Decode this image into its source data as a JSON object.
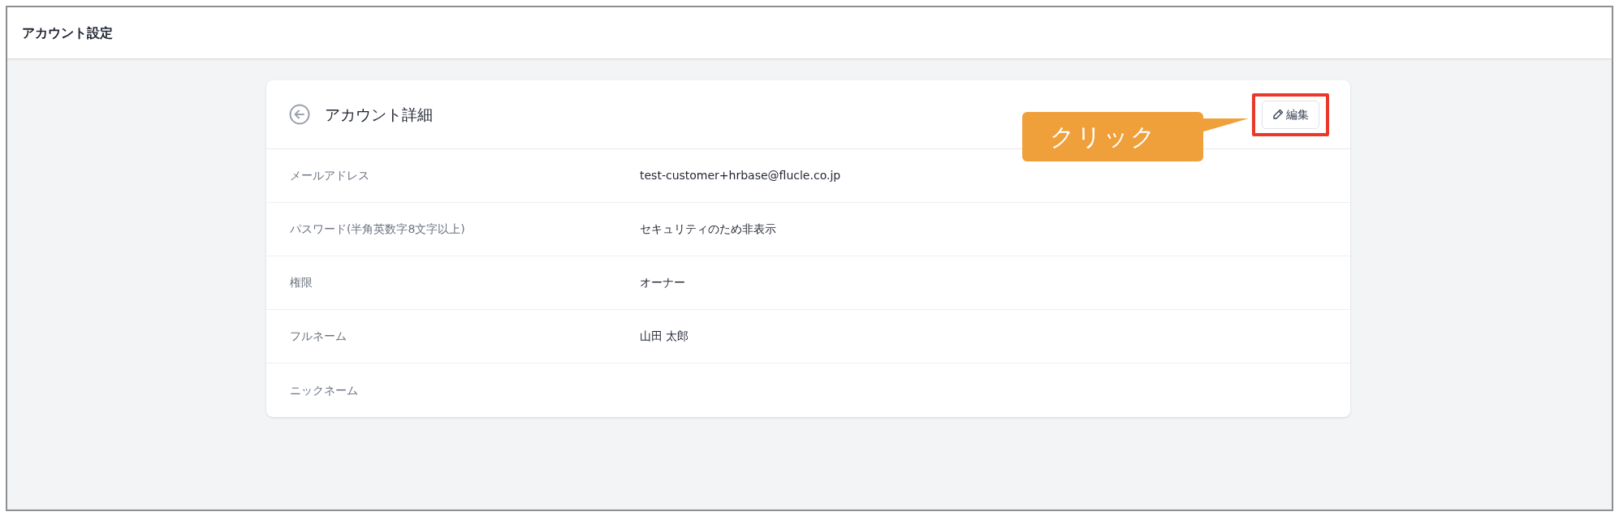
{
  "page": {
    "title": "アカウント設定"
  },
  "card": {
    "title": "アカウント詳細",
    "edit_button": "編集"
  },
  "fields": [
    {
      "label": "メールアドレス",
      "value": "test-customer+hrbase@flucle.co.jp"
    },
    {
      "label": "パスワード(半角英数字8文字以上)",
      "value": "セキュリティのため非表示"
    },
    {
      "label": "権限",
      "value": "オーナー"
    },
    {
      "label": "フルネーム",
      "value": "山田 太郎"
    },
    {
      "label": "ニックネーム"
    }
  ],
  "annotation": {
    "text": "クリック"
  }
}
